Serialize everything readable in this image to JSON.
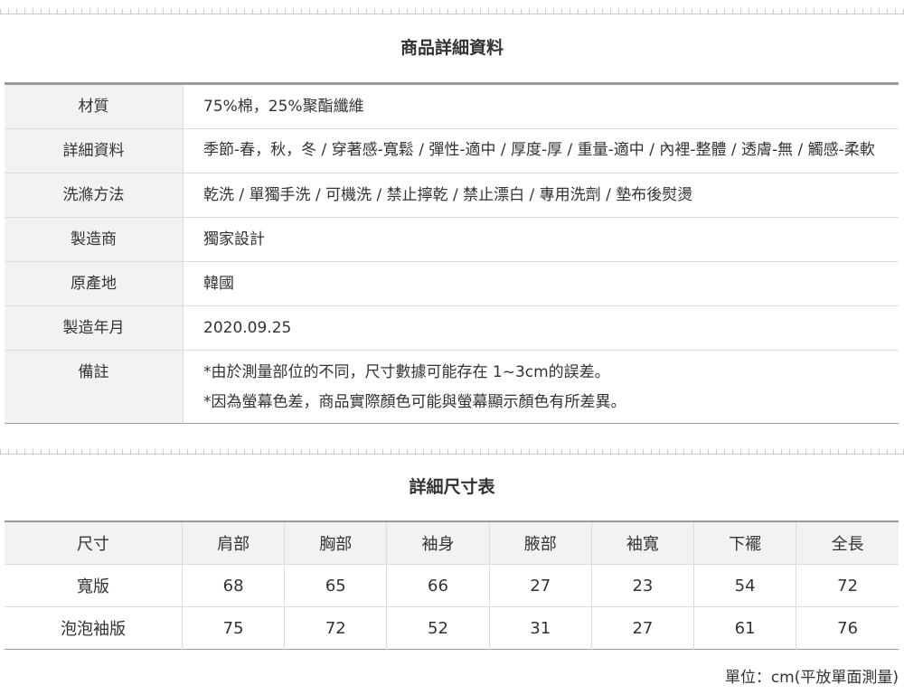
{
  "detail": {
    "title": "商品詳細資料",
    "rows": [
      {
        "label": "材質",
        "value": "75%棉，25%聚酯纖維"
      },
      {
        "label": "詳細資料",
        "value": "季節-春，秋，冬 / 穿著感-寬鬆 / 彈性-適中 / 厚度-厚 / 重量-適中 / 內裡-整體 / 透膚-無 / 觸感-柔軟"
      },
      {
        "label": "洗滌方法",
        "value": "乾洗 / 單獨手洗 / 可機洗 / 禁止擰乾 / 禁止漂白 / 專用洗劑 / 墊布後熨燙"
      },
      {
        "label": "製造商",
        "value": "獨家設計"
      },
      {
        "label": "原產地",
        "value": "韓國"
      },
      {
        "label": "製造年月",
        "value": "2020.09.25"
      },
      {
        "label": "備註",
        "note1": "*由於測量部位的不同，尺寸數據可能存在 1~3cm的誤差。",
        "note2": "*因為螢幕色差，商品實際顏色可能與螢幕顯示顏色有所差異。"
      }
    ]
  },
  "size": {
    "title": "詳細尺寸表",
    "headers": [
      "尺寸",
      "肩部",
      "胸部",
      "袖身",
      "腋部",
      "袖寬",
      "下襬",
      "全長"
    ],
    "rows": [
      [
        "寬版",
        "68",
        "65",
        "66",
        "27",
        "23",
        "54",
        "72"
      ],
      [
        "泡泡袖版",
        "75",
        "72",
        "52",
        "31",
        "27",
        "61",
        "76"
      ]
    ],
    "unit_note": "單位：cm(平放單面測量)"
  }
}
